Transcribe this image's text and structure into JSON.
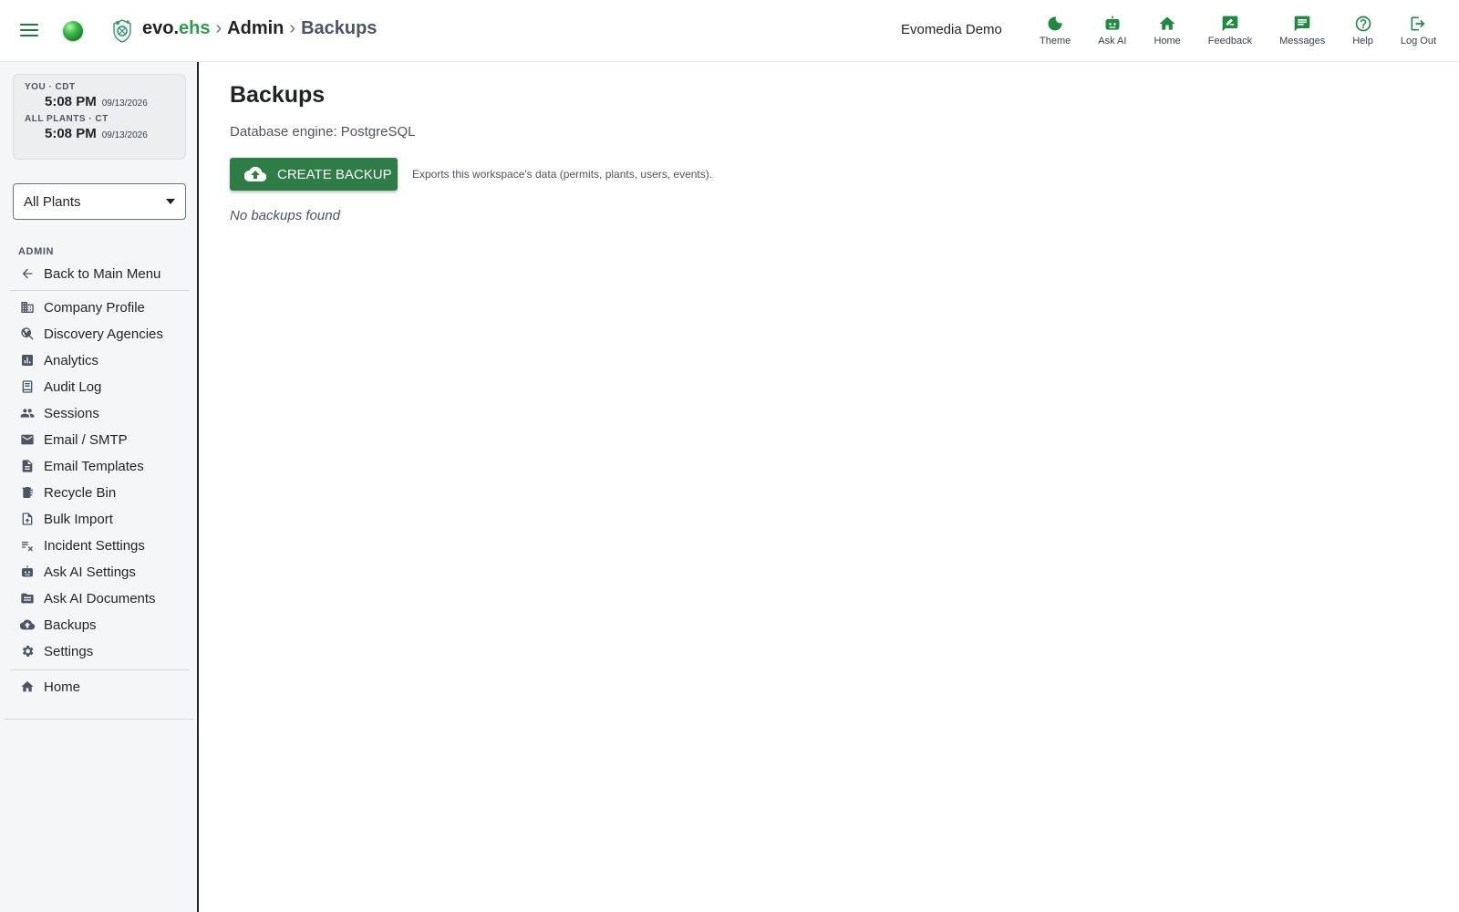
{
  "header": {
    "brand_evo": "evo.",
    "brand_ehs": "ehs",
    "crumb_sep": "›",
    "crumb_admin": "Admin",
    "crumb_current": "Backups",
    "org_name": "Evomedia Demo",
    "actions": [
      {
        "label": "Theme",
        "icon": "moon-icon"
      },
      {
        "label": "Ask AI",
        "icon": "robot-icon"
      },
      {
        "label": "Home",
        "icon": "home-icon"
      },
      {
        "label": "Feedback",
        "icon": "feedback-icon"
      },
      {
        "label": "Messages",
        "icon": "message-icon"
      },
      {
        "label": "Help",
        "icon": "help-icon"
      },
      {
        "label": "Log Out",
        "icon": "logout-icon"
      }
    ]
  },
  "clock": {
    "you_label": "YOU · CDT",
    "you_time": "5:08 PM",
    "you_date": "09/13/2026",
    "plants_label": "ALL PLANTS · CT",
    "plants_time": "5:08 PM",
    "plants_date": "09/13/2026"
  },
  "plant_select": {
    "value": "All Plants"
  },
  "sidebar": {
    "section": "ADMIN",
    "back": "Back to Main Menu",
    "items": [
      {
        "label": "Company Profile",
        "icon": "building-icon"
      },
      {
        "label": "Discovery Agencies",
        "icon": "globe-search-icon"
      },
      {
        "label": "Analytics",
        "icon": "analytics-icon"
      },
      {
        "label": "Audit Log",
        "icon": "audit-log-icon"
      },
      {
        "label": "Sessions",
        "icon": "people-icon"
      },
      {
        "label": "Email / SMTP",
        "icon": "mail-icon"
      },
      {
        "label": "Email Templates",
        "icon": "document-icon"
      },
      {
        "label": "Recycle Bin",
        "icon": "recycle-bin-icon"
      },
      {
        "label": "Bulk Import",
        "icon": "file-upload-icon"
      },
      {
        "label": "Incident Settings",
        "icon": "checklist-icon"
      },
      {
        "label": "Ask AI Settings",
        "icon": "robot-icon"
      },
      {
        "label": "Ask AI Documents",
        "icon": "folder-icon"
      },
      {
        "label": "Backups",
        "icon": "cloud-upload-icon"
      },
      {
        "label": "Settings",
        "icon": "gear-icon"
      }
    ],
    "home": "Home"
  },
  "main": {
    "title": "Backups",
    "db_engine": "Database engine: PostgreSQL",
    "create_button": "CREATE BACKUP",
    "create_hint": "Exports this workspace's data (permits, plants, users, events).",
    "empty_text": "No backups found"
  },
  "colors": {
    "accent": "#2e7d46",
    "brand_green": "#2e9d4a",
    "icon_green": "#1e8c3e"
  }
}
